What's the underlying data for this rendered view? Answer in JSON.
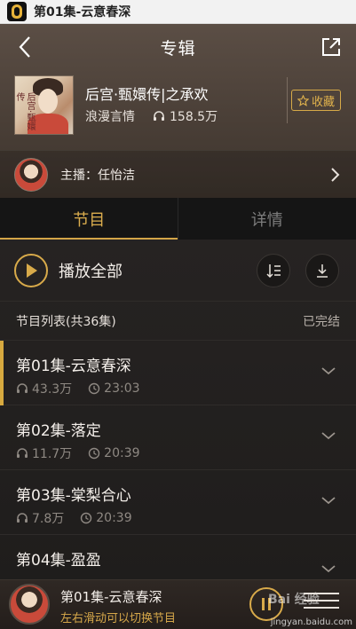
{
  "statusbar": {
    "title": "第01集-云意春深"
  },
  "navbar": {
    "title": "专辑"
  },
  "album": {
    "cover_text": "后宫·甄嬛传",
    "title": "后宫·甄嬛传|之承欢",
    "category": "浪漫言情",
    "plays": "158.5万",
    "favorite_label": "收藏"
  },
  "anchor": {
    "label": "主播：任怡洁"
  },
  "tabs": {
    "episodes": "节目",
    "details": "详情"
  },
  "toolbar": {
    "play_all": "播放全部"
  },
  "list": {
    "header": "节目列表(共36集)",
    "status": "已完结",
    "episodes": [
      {
        "title": "第01集-云意春深",
        "plays": "43.3万",
        "duration": "23:03"
      },
      {
        "title": "第02集-落定",
        "plays": "11.7万",
        "duration": "20:39"
      },
      {
        "title": "第03集-棠梨合心",
        "plays": "7.8万",
        "duration": "20:39"
      },
      {
        "title": "第04集-盈盈",
        "plays": "",
        "duration": ""
      }
    ]
  },
  "player": {
    "title": "第01集-云意春深",
    "hint": "左右滑动可以切换节目"
  },
  "watermark": {
    "logo": "Bai 经验",
    "url": "jingyan.baidu.com"
  },
  "colors": {
    "accent": "#d7a93f",
    "background": "#1f1d1c",
    "hero": "#4a3f37"
  }
}
